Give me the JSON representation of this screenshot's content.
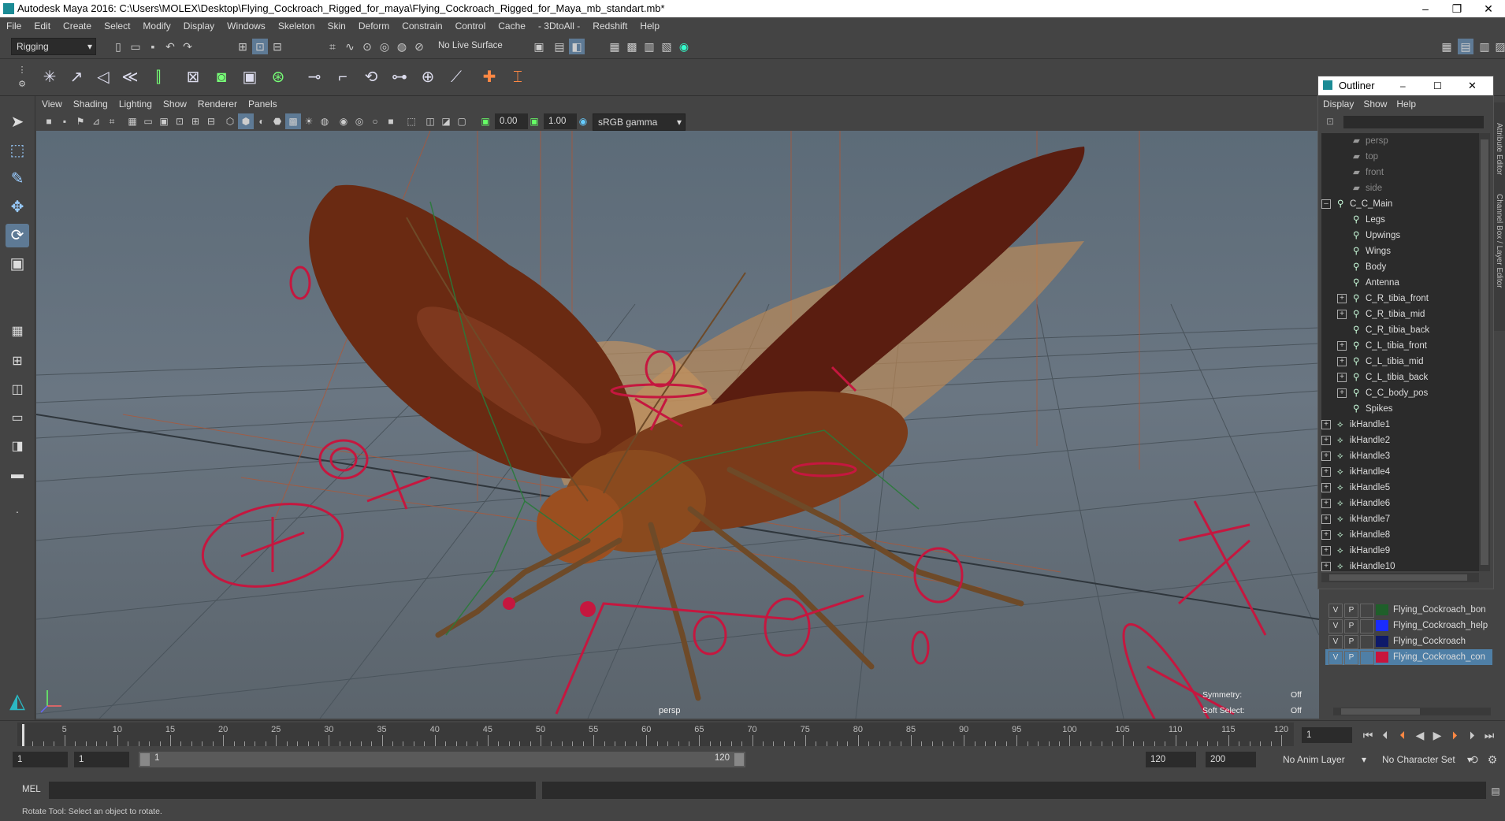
{
  "window": {
    "title": "Autodesk Maya 2016: C:\\Users\\MOLEX\\Desktop\\Flying_Cockroach_Rigged_for_maya\\Flying_Cockroach_Rigged_for_Maya_mb_standart.mb*",
    "min": "–",
    "restore": "❐",
    "close": "✕"
  },
  "menubar": [
    "File",
    "Edit",
    "Create",
    "Select",
    "Modify",
    "Display",
    "Windows",
    "Skeleton",
    "Skin",
    "Deform",
    "Constrain",
    "Control",
    "Cache",
    "- 3DtoAll -",
    "Redshift",
    "Help"
  ],
  "statusline": {
    "menuset": "Rigging",
    "live_surface": "No Live Surface"
  },
  "viewport": {
    "menu": [
      "View",
      "Shading",
      "Lighting",
      "Show",
      "Renderer",
      "Panels"
    ],
    "exposure": "0.00",
    "gamma": "1.00",
    "colorspace": "sRGB gamma",
    "camera_label": "persp",
    "hud": {
      "symmetry_label": "Symmetry:",
      "symmetry_value": "Off",
      "softselect_label": "Soft Select:",
      "softselect_value": "Off"
    }
  },
  "outliner": {
    "title": "Outliner",
    "menu": [
      "Display",
      "Show",
      "Help"
    ],
    "items": [
      {
        "label": "persp",
        "kind": "camera",
        "indent": 1,
        "expander": ""
      },
      {
        "label": "top",
        "kind": "camera",
        "indent": 1,
        "expander": ""
      },
      {
        "label": "front",
        "kind": "camera",
        "indent": 1,
        "expander": ""
      },
      {
        "label": "side",
        "kind": "camera",
        "indent": 1,
        "expander": ""
      },
      {
        "label": "C_C_Main",
        "kind": "group",
        "indent": 0,
        "expander": "–"
      },
      {
        "label": "Legs",
        "kind": "group",
        "indent": 1,
        "expander": ""
      },
      {
        "label": "Upwings",
        "kind": "group",
        "indent": 1,
        "expander": ""
      },
      {
        "label": "Wings",
        "kind": "group",
        "indent": 1,
        "expander": ""
      },
      {
        "label": "Body",
        "kind": "group",
        "indent": 1,
        "expander": ""
      },
      {
        "label": "Antenna",
        "kind": "group",
        "indent": 1,
        "expander": ""
      },
      {
        "label": "C_R_tibia_front",
        "kind": "group",
        "indent": 1,
        "expander": "+"
      },
      {
        "label": "C_R_tibia_mid",
        "kind": "group",
        "indent": 1,
        "expander": "+"
      },
      {
        "label": "C_R_tibia_back",
        "kind": "group",
        "indent": 1,
        "expander": ""
      },
      {
        "label": "C_L_tibia_front",
        "kind": "group",
        "indent": 1,
        "expander": "+"
      },
      {
        "label": "C_L_tibia_mid",
        "kind": "group",
        "indent": 1,
        "expander": "+"
      },
      {
        "label": "C_L_tibia_back",
        "kind": "group",
        "indent": 1,
        "expander": "+"
      },
      {
        "label": "C_C_body_pos",
        "kind": "group",
        "indent": 1,
        "expander": "+"
      },
      {
        "label": "Spikes",
        "kind": "group",
        "indent": 1,
        "expander": ""
      },
      {
        "label": "ikHandle1",
        "kind": "ik",
        "indent": 0,
        "expander": "+"
      },
      {
        "label": "ikHandle2",
        "kind": "ik",
        "indent": 0,
        "expander": "+"
      },
      {
        "label": "ikHandle3",
        "kind": "ik",
        "indent": 0,
        "expander": "+"
      },
      {
        "label": "ikHandle4",
        "kind": "ik",
        "indent": 0,
        "expander": "+"
      },
      {
        "label": "ikHandle5",
        "kind": "ik",
        "indent": 0,
        "expander": "+"
      },
      {
        "label": "ikHandle6",
        "kind": "ik",
        "indent": 0,
        "expander": "+"
      },
      {
        "label": "ikHandle7",
        "kind": "ik",
        "indent": 0,
        "expander": "+"
      },
      {
        "label": "ikHandle8",
        "kind": "ik",
        "indent": 0,
        "expander": "+"
      },
      {
        "label": "ikHandle9",
        "kind": "ik",
        "indent": 0,
        "expander": "+"
      },
      {
        "label": "ikHandle10",
        "kind": "ik",
        "indent": 0,
        "expander": "+"
      }
    ]
  },
  "layers": [
    {
      "v": "V",
      "p": "P",
      "name": "Flying_Cockroach_bon",
      "color": "#1f5f2a",
      "selected": false
    },
    {
      "v": "V",
      "p": "P",
      "name": "Flying_Cockroach_help",
      "color": "#1a2cff",
      "selected": false
    },
    {
      "v": "V",
      "p": "P",
      "name": "Flying_Cockroach",
      "color": "#0e1a6a",
      "selected": false
    },
    {
      "v": "V",
      "p": "P",
      "name": "Flying_Cockroach_con",
      "color": "#c8143c",
      "selected": true
    }
  ],
  "timeslider": {
    "ticks": [
      "1",
      "5",
      "10",
      "15",
      "20",
      "25",
      "30",
      "35",
      "40",
      "45",
      "50",
      "55",
      "60",
      "65",
      "70",
      "75",
      "80",
      "85",
      "90",
      "95",
      "100",
      "105",
      "110",
      "115",
      "120"
    ],
    "current_frame": "1"
  },
  "range": {
    "start": "1",
    "anim_start": "1",
    "range_start": "1",
    "range_end": "120",
    "end": "120",
    "anim_end": "200",
    "anim_layer": "No Anim Layer",
    "character_set": "No Character Set"
  },
  "cmd": {
    "label": "MEL"
  },
  "help": {
    "text": "Rotate Tool: Select an object to rotate."
  },
  "side_tabs": {
    "attr_editor": "Attribute Editor",
    "channel_box": "Channel Box / Layer Editor"
  }
}
